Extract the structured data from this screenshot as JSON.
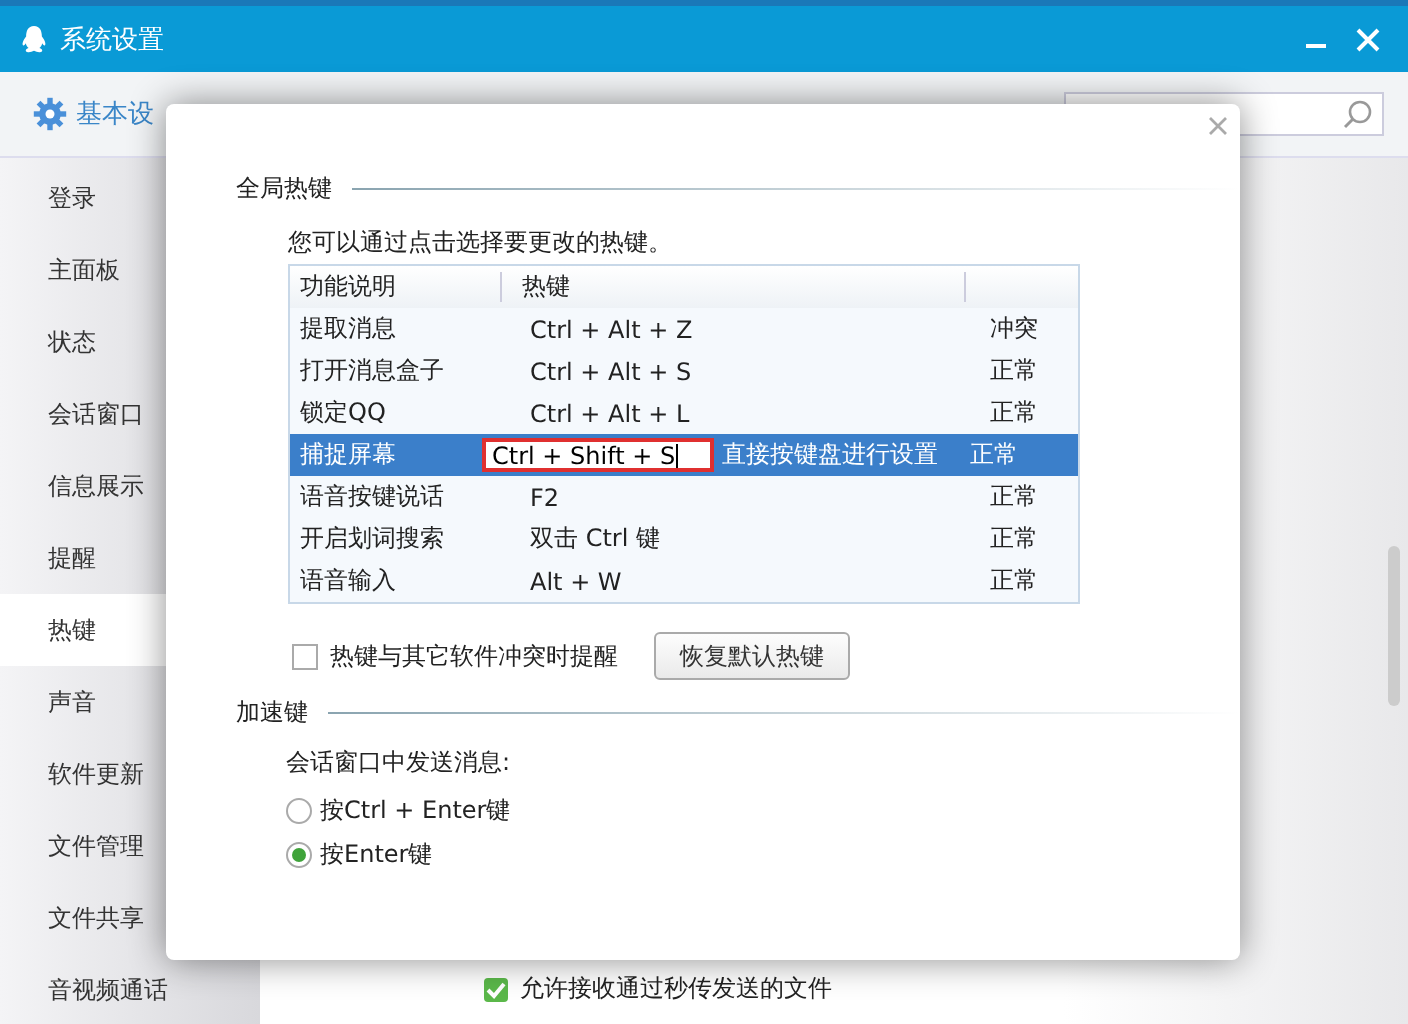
{
  "window": {
    "title": "系统设置"
  },
  "tabs": [
    {
      "label": "基本设",
      "selected": true
    }
  ],
  "sidebar": {
    "items": [
      {
        "label": "登录",
        "selected": false
      },
      {
        "label": "主面板",
        "selected": false
      },
      {
        "label": "状态",
        "selected": false
      },
      {
        "label": "会话窗口",
        "selected": false
      },
      {
        "label": "信息展示",
        "selected": false
      },
      {
        "label": "提醒",
        "selected": false
      },
      {
        "label": "热键",
        "selected": true
      },
      {
        "label": "声音",
        "selected": false
      },
      {
        "label": "软件更新",
        "selected": false
      },
      {
        "label": "文件管理",
        "selected": false
      },
      {
        "label": "文件共享",
        "selected": false
      },
      {
        "label": "音视频通话",
        "selected": false
      }
    ]
  },
  "background_option": {
    "label": "允许接收通过秒传发送的文件",
    "checked": true
  },
  "dialog": {
    "global_hotkeys": {
      "title": "全局热键",
      "description": "您可以通过点击选择要更改的热键。",
      "table": {
        "columns": [
          "功能说明",
          "热键"
        ],
        "rows": [
          {
            "name": "提取消息",
            "hotkey": "Ctrl + Alt + Z",
            "status": "冲突",
            "selected": false,
            "editing": false
          },
          {
            "name": "打开消息盒子",
            "hotkey": "Ctrl + Alt + S",
            "status": "正常",
            "selected": false,
            "editing": false
          },
          {
            "name": "锁定QQ",
            "hotkey": "Ctrl + Alt + L",
            "status": "正常",
            "selected": false,
            "editing": false
          },
          {
            "name": "捕捉屏幕",
            "hotkey": "Ctrl + Shift + S",
            "hint": "直接按键盘进行设置",
            "status": "正常",
            "selected": true,
            "editing": true
          },
          {
            "name": "语音按键说话",
            "hotkey": "F2",
            "status": "正常",
            "selected": false,
            "editing": false
          },
          {
            "name": "开启划词搜索",
            "hotkey": "双击 Ctrl 键",
            "status": "正常",
            "selected": false,
            "editing": false
          },
          {
            "name": "语音输入",
            "hotkey": "Alt + W",
            "status": "正常",
            "selected": false,
            "editing": false
          }
        ]
      },
      "conflict_reminder": {
        "label": "热键与其它软件冲突时提醒",
        "checked": false
      },
      "restore_button": "恢复默认热键"
    },
    "accelerator": {
      "title": "加速键",
      "prompt": "会话窗口中发送消息:",
      "options": [
        {
          "label": "按Ctrl + Enter键",
          "selected": false
        },
        {
          "label": "按Enter键",
          "selected": true
        }
      ]
    }
  }
}
